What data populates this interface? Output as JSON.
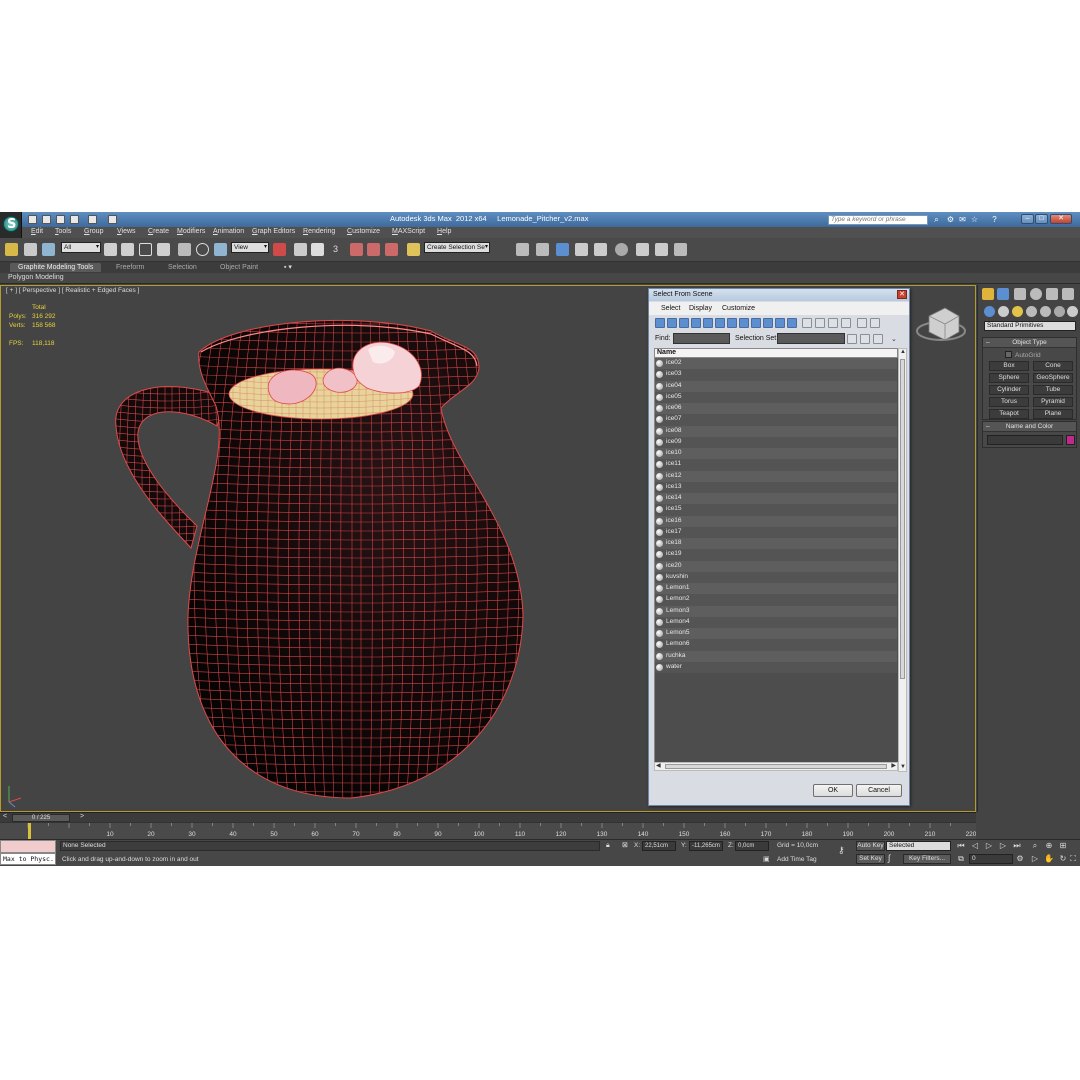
{
  "window": {
    "title": "Autodesk 3ds Max  2012 x64     Lemonade_Pitcher_v2.max",
    "search_placeholder": "Type a keyword or phrase"
  },
  "menu": [
    "Edit",
    "Tools",
    "Group",
    "Views",
    "Create",
    "Modifiers",
    "Animation",
    "Graph Editors",
    "Rendering",
    "Customize",
    "MAXScript",
    "Help"
  ],
  "toolbar": {
    "filter": "All",
    "ref_coord": "View",
    "snap_spinner": "3",
    "selection_set": "Create Selection Se"
  },
  "ribbon": {
    "tabs": [
      "Graphite Modeling Tools",
      "Freeform",
      "Selection",
      "Object Paint"
    ],
    "panel": "Polygon Modeling"
  },
  "viewport": {
    "label": "[ + ] [ Perspective ] [ Realistic + Edged Faces ]",
    "stats": {
      "total_label": "Total",
      "polys_label": "Polys:",
      "polys": "316 292",
      "verts_label": "Verts:",
      "verts": "158 568",
      "fps_label": "FPS:",
      "fps": "118,118"
    },
    "wire_color": "#e04a4a"
  },
  "dialog": {
    "title": "Select From Scene",
    "menu": [
      "Select",
      "Display",
      "Customize"
    ],
    "find_label": "Find:",
    "selset_label": "Selection Set:",
    "column_header": "Name",
    "items": [
      "ice02",
      "ice03",
      "ice04",
      "ice05",
      "ice06",
      "ice07",
      "ice08",
      "ice09",
      "ice10",
      "ice11",
      "ice12",
      "ice13",
      "ice14",
      "ice15",
      "ice16",
      "ice17",
      "ice18",
      "ice19",
      "ice20",
      "kuvshin",
      "Lemon1",
      "Lemon2",
      "Lemon3",
      "Lemon4",
      "Lemon5",
      "Lemon6",
      "ruchka",
      "water"
    ],
    "ok_label": "OK",
    "cancel_label": "Cancel"
  },
  "command_panel": {
    "dropdown": "Standard Primitives",
    "object_type_title": "Object Type",
    "autogrid": "AutoGrid",
    "primitives": [
      "Box",
      "Cone",
      "Sphere",
      "GeoSphere",
      "Cylinder",
      "Tube",
      "Torus",
      "Pyramid",
      "Teapot",
      "Plane"
    ],
    "name_color_title": "Name and Color",
    "swatch_color": "#c0288a"
  },
  "timeline": {
    "frame_counter": "0 / 225",
    "ticks": [
      "0",
      "10",
      "20",
      "30",
      "40",
      "50",
      "60",
      "70",
      "80",
      "90",
      "100",
      "110",
      "120",
      "130",
      "140",
      "150",
      "160",
      "170",
      "180",
      "190",
      "200",
      "210",
      "220"
    ]
  },
  "status": {
    "maxscript": "Max to Physc.",
    "selection": "None Selected",
    "prompt": "Click and drag up-and-down to zoom in and out",
    "x_label": "X:",
    "x": "22,51cm",
    "y_label": "Y:",
    "y": "-11,265cm",
    "z_label": "Z:",
    "z": "0,0cm",
    "grid": "Grid = 10,0cm",
    "add_time_tag": "Add Time Tag",
    "auto_key": "Auto Key",
    "set_key": "Set Key",
    "selected": "Selected",
    "key_filters": "Key Filters...",
    "frame": "0"
  }
}
